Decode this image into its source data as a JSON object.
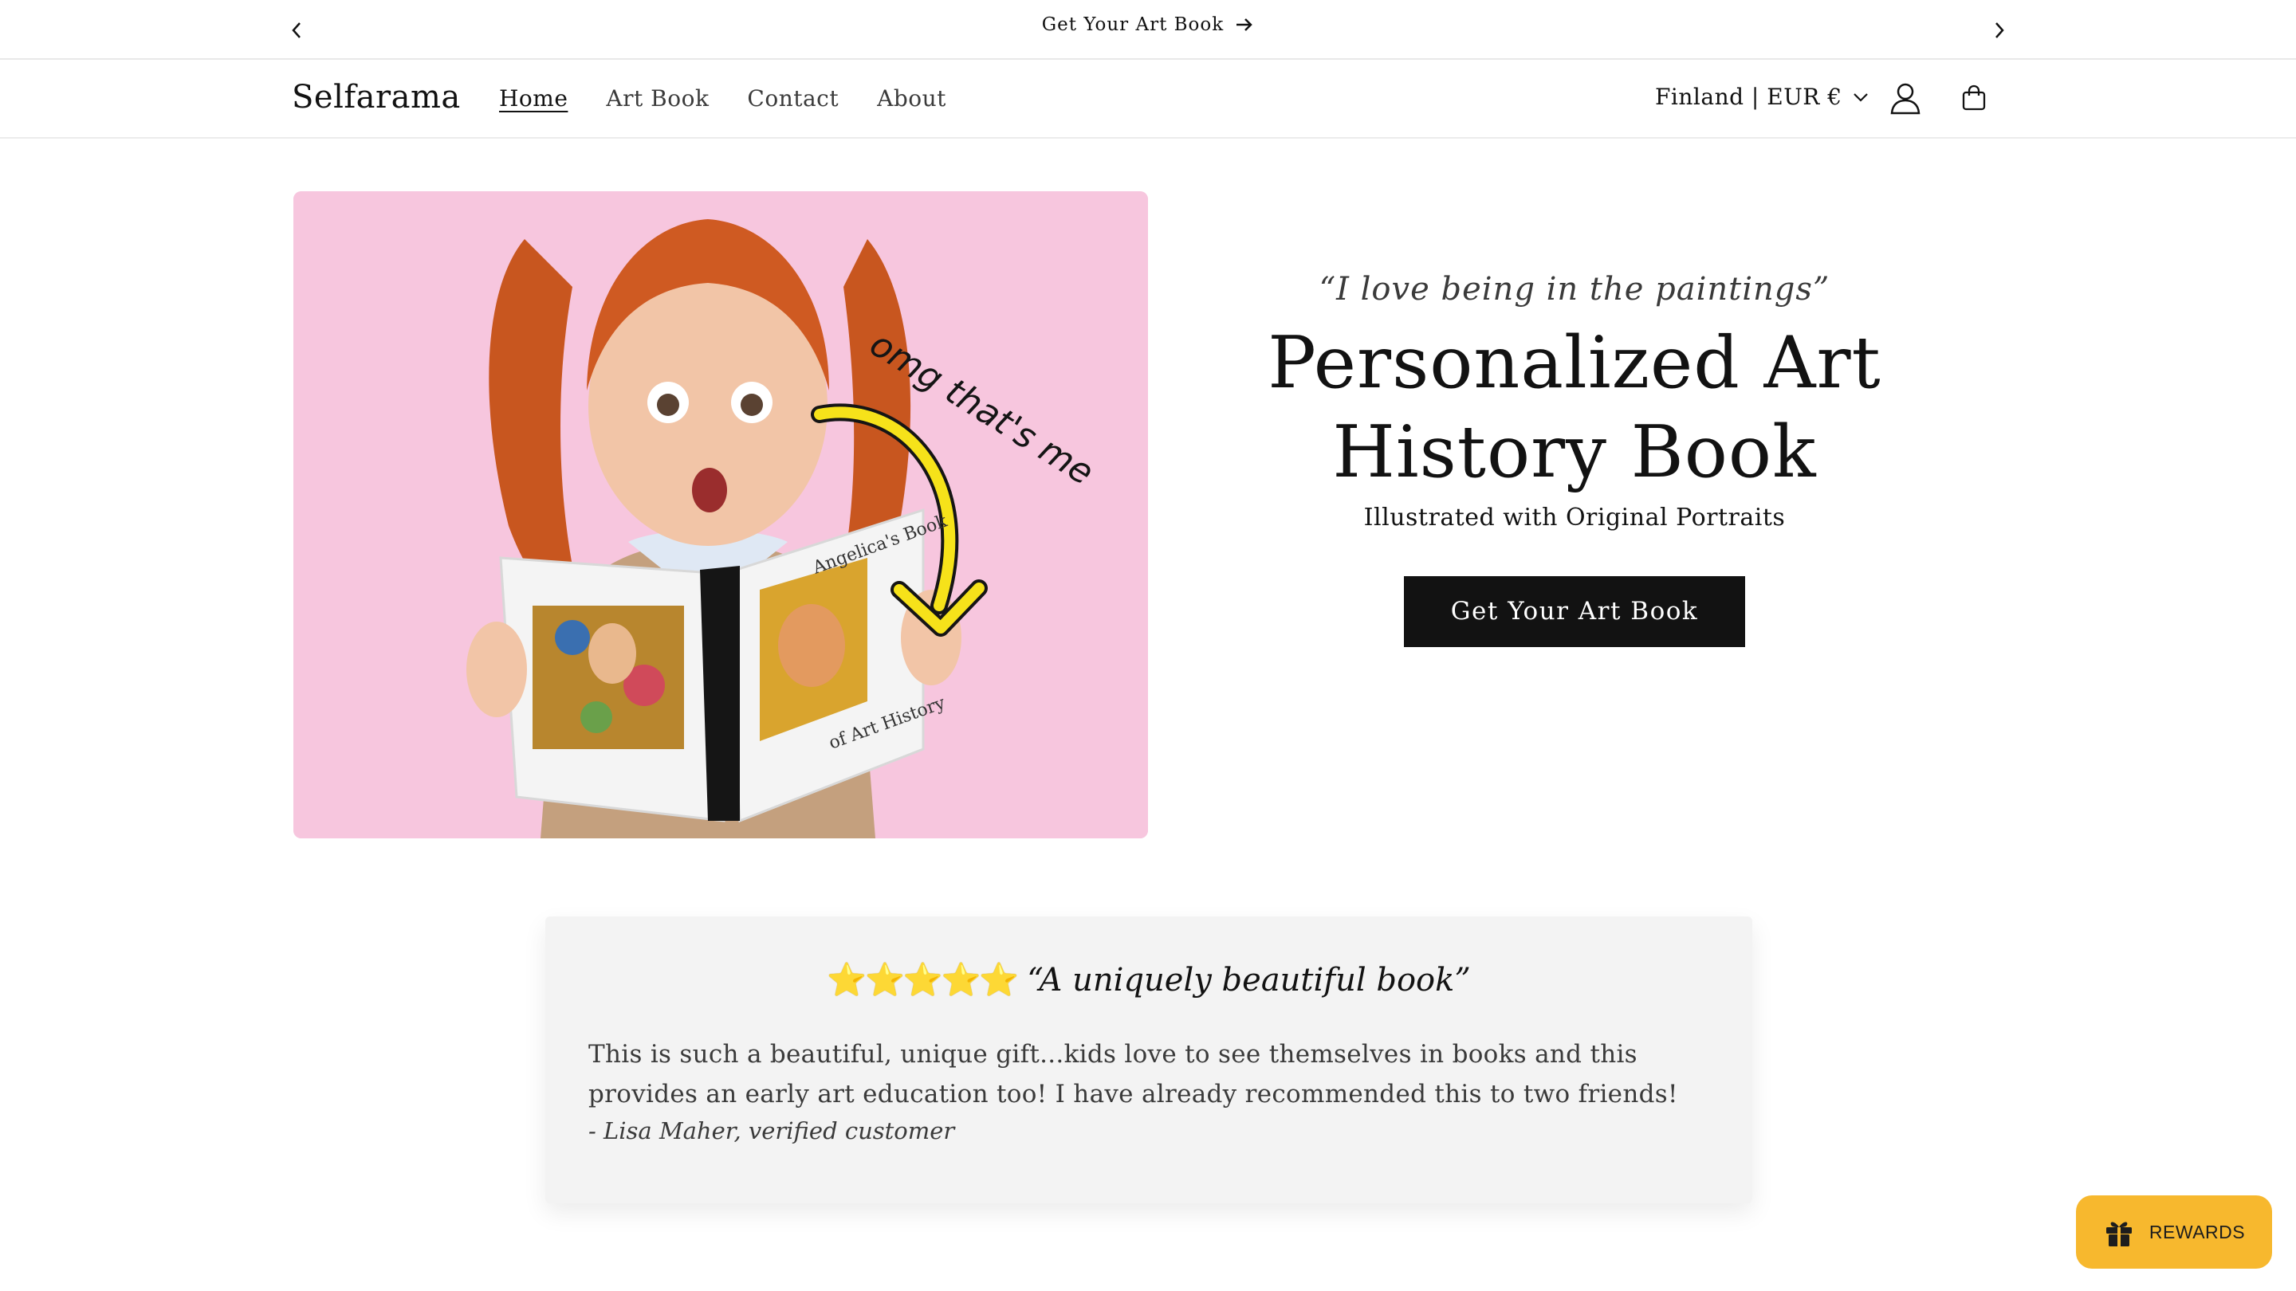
{
  "announcement": {
    "text": "Get Your Art Book",
    "prev_icon": "chevron-left-icon",
    "next_icon": "chevron-right-icon",
    "arrow_icon": "arrow-right-icon"
  },
  "header": {
    "logo": "Selfarama",
    "nav": [
      {
        "label": "Home",
        "active": true
      },
      {
        "label": "Art Book",
        "active": false
      },
      {
        "label": "Contact",
        "active": false
      },
      {
        "label": "About",
        "active": false
      }
    ],
    "locale": "Finland | EUR €",
    "account_icon": "user-icon",
    "cart_icon": "shopping-bag-icon"
  },
  "hero": {
    "image_annotation": "omg that's me",
    "book_title_top": "Angelica's Book",
    "book_title_bottom": "of Art History",
    "quote": "“I love being in the paintings”",
    "title": "Personalized Art History Book",
    "subtitle": "Illustrated with Original Portraits",
    "cta": "Get Your Art Book"
  },
  "review": {
    "rating": 5,
    "stars": "⭐⭐⭐⭐⭐",
    "title": "“A uniquely beautiful book”",
    "body": "This is such a beautiful, unique gift...kids love to see themselves in books and this provides an early art education too! I have already recommended this to two friends!",
    "author": "- Lisa Maher, verified customer"
  },
  "rewards": {
    "label": "REWARDS",
    "icon": "gift-icon"
  },
  "colors": {
    "hero_bg": "#f7c6de",
    "button_bg": "#121212",
    "rewards_bg": "#f7b82e",
    "review_bg": "#f3f3f3"
  }
}
